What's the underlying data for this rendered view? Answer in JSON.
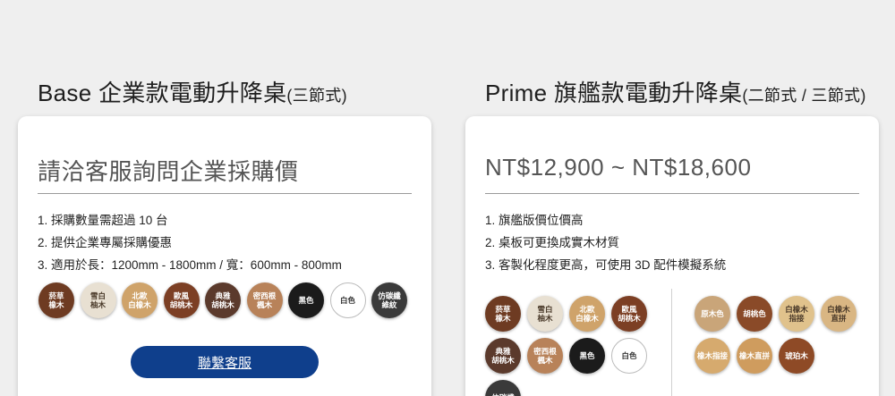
{
  "left": {
    "title": "Base 企業款電動升降桌",
    "title_suffix": "(三節式)",
    "price": "請洽客服詢問企業採購價",
    "features": [
      "1. 採購數量需超過 10 台",
      "2. 提供企業專屬採購優惠",
      "3. 適用於長：1200mm - 1800mm / 寬：600mm - 800mm"
    ],
    "swatches": [
      {
        "label": "菸草\n橡木",
        "color": "#6e3b22"
      },
      {
        "label": "雪白\n柚木",
        "color": "#e8e0d2"
      },
      {
        "label": "北歐\n白橡木",
        "color": "#cfa36a"
      },
      {
        "label": "歐風\n胡桃木",
        "color": "#7c3f24"
      },
      {
        "label": "典雅\n胡桃木",
        "color": "#5b3a2c"
      },
      {
        "label": "密西根\n楓木",
        "color": "#b88259"
      },
      {
        "label": "黑色",
        "color": "#1b1b1b"
      },
      {
        "label": "白色",
        "color": "#ffffff"
      },
      {
        "label": "仿碳纖\n維紋",
        "color": "#3a3a3a"
      }
    ],
    "contact_label": "聯繫客服"
  },
  "right": {
    "title": "Prime 旗艦款電動升降桌",
    "title_suffix": "(二節式 / 三節式)",
    "price": "NT$12,900 ~ NT$18,600",
    "features": [
      "1. 旗艦版價位價高",
      "2. 桌板可更換成實木材質",
      "3. 客製化程度更高，可使用 3D 配件模擬系統"
    ],
    "swatches_standard": [
      {
        "label": "菸草\n橡木",
        "color": "#6e3b22"
      },
      {
        "label": "雪白\n柚木",
        "color": "#e8e0d2"
      },
      {
        "label": "北歐\n白橡木",
        "color": "#cfa36a"
      },
      {
        "label": "歐風\n胡桃木",
        "color": "#7c3f24"
      },
      {
        "label": "典雅\n胡桃木",
        "color": "#5b3a2c"
      },
      {
        "label": "密西根\n楓木",
        "color": "#b88259"
      },
      {
        "label": "黑色",
        "color": "#1b1b1b"
      },
      {
        "label": "白色",
        "color": "#ffffff"
      },
      {
        "label": "仿碳纖",
        "color": "#3a3a3a"
      }
    ],
    "swatches_solid": [
      {
        "label": "原木色",
        "color": "#c9a579"
      },
      {
        "label": "胡桃色",
        "color": "#8a4a28"
      },
      {
        "label": "白橡木\n指接",
        "color": "#e0c28c"
      },
      {
        "label": "白橡木\n直拼",
        "color": "#d9b683"
      },
      {
        "label": "橡木指接",
        "color": "#d6aa6e"
      },
      {
        "label": "橡木直拼",
        "color": "#cf9c5e"
      },
      {
        "label": "琥珀木",
        "color": "#8e4a26"
      }
    ]
  }
}
